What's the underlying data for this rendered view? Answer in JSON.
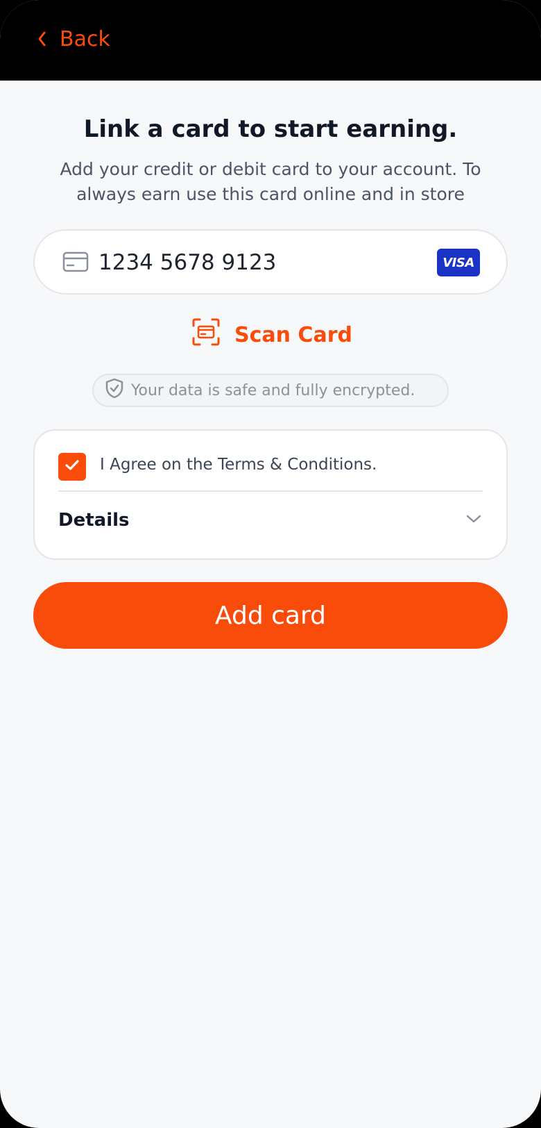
{
  "header": {
    "back_label": "Back"
  },
  "main": {
    "title": "Link a card to start earning.",
    "subtitle": "Add your credit or debit card to your account. To always earn use this card online and in store",
    "card_input": {
      "value": "1234 5678 9123",
      "brand": "VISA"
    },
    "scan_label": "Scan Card",
    "security_note": "Your data is safe and fully encrypted.",
    "terms": {
      "checked": true,
      "label": "I Agree on the Terms & Conditions.",
      "details_label": "Details"
    },
    "add_button_label": "Add card"
  },
  "colors": {
    "accent": "#f94c0b",
    "visa_blue": "#1b33c5",
    "background": "#f7f8fa"
  },
  "icons": {
    "back": "chevron-left-icon",
    "card": "credit-card-icon",
    "scan": "scan-frame-icon",
    "secure": "shield-check-icon",
    "checkbox": "check-icon",
    "expand": "chevron-down-icon"
  }
}
